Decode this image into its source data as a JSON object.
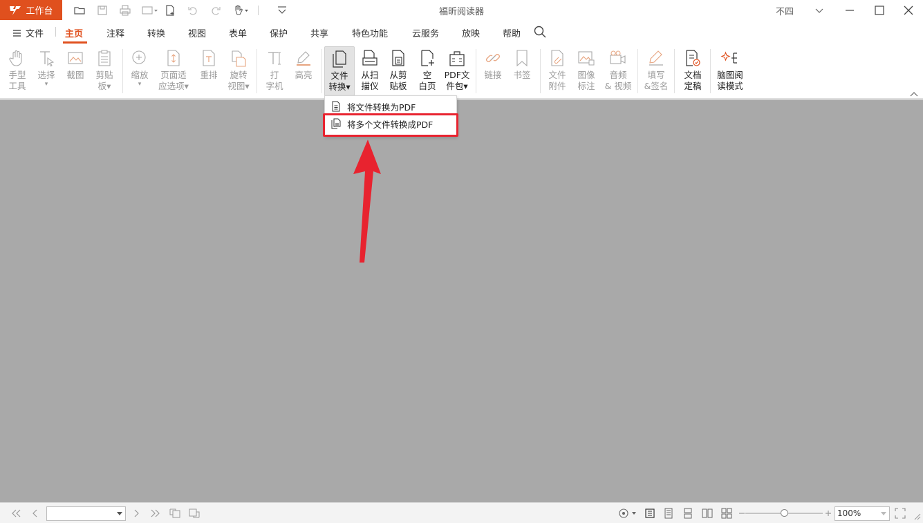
{
  "titlebar": {
    "workbench_label": "工作台",
    "app_title": "福昕阅读器",
    "user_name": "不四"
  },
  "menubar": {
    "file_label": "文件",
    "tabs": [
      "主页",
      "注释",
      "转换",
      "视图",
      "表单",
      "保护",
      "共享",
      "特色功能",
      "云服务",
      "放映",
      "帮助"
    ],
    "active_tab": "主页"
  },
  "ribbon": {
    "hand_tool": "手型\n工具",
    "select": "选择",
    "screenshot": "截图",
    "clipboard": "剪贴\n板▾",
    "zoom": "缩放",
    "page_fit": "页面适\n应选项▾",
    "reflow": "重排",
    "rotate_view": "旋转\n视图▾",
    "typewriter": "打\n字机",
    "highlight": "高亮",
    "file_convert": "文件\n转换▾",
    "from_scanner": "从扫\n描仪",
    "from_clipboard": "从剪\n贴板",
    "blank_page": "空\n白页",
    "pdf_package": "PDF文\n件包▾",
    "link": "链接",
    "bookmark": "书签",
    "file_attachment": "文件\n附件",
    "image_annotation": "图像\n标注",
    "audio_video": "音频\n& 视频",
    "fill_sign": "填写\n&签名",
    "doc_finalize": "文档\n定稿",
    "mindmap_read": "脑图阅\n读模式"
  },
  "dropdown": {
    "item1": "将文件转换为PDF",
    "item2": "将多个文件转换成PDF"
  },
  "statusbar": {
    "page_value": "",
    "zoom_value": "100%"
  },
  "colors": {
    "accent": "#e0501e",
    "highlight_box": "#e8232f",
    "arrow": "#e8232f",
    "document_bg": "#a9a9a9"
  }
}
